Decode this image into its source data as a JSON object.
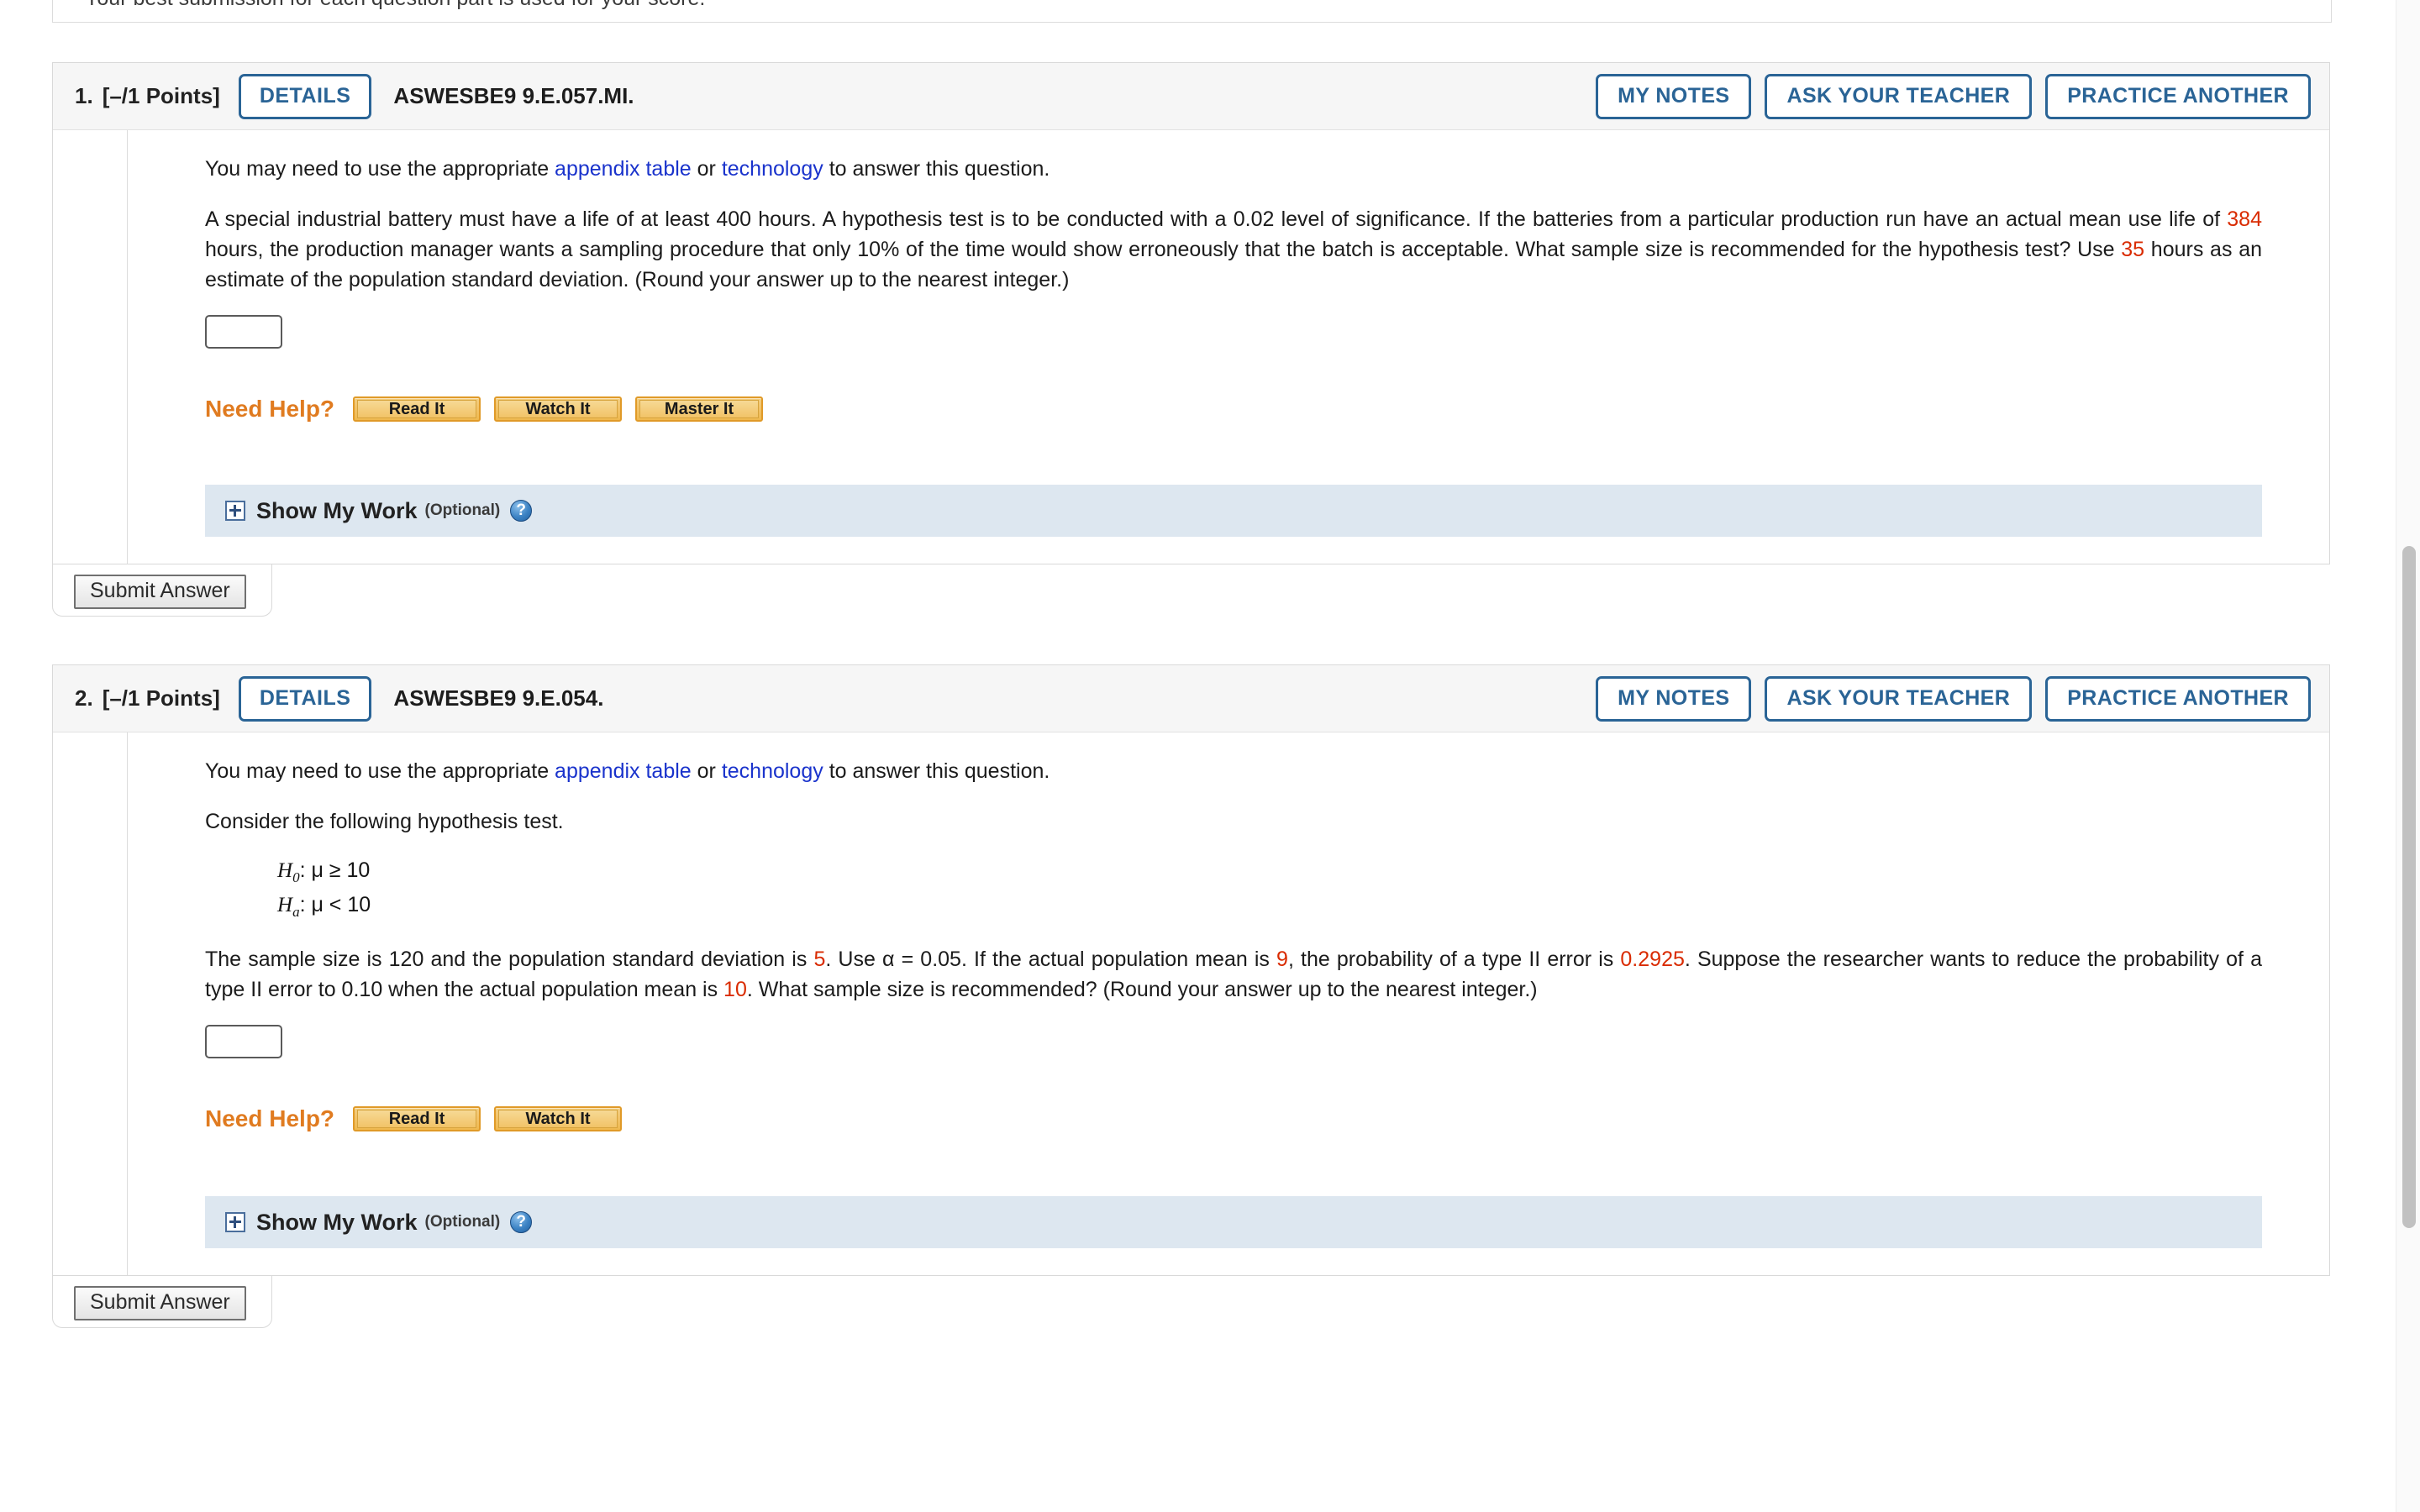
{
  "banner": {
    "text": "Your best submission for each question part is used for your score."
  },
  "intro_line": {
    "prefix": "You may need to use the appropriate ",
    "link1": "appendix table",
    "middle": " or ",
    "link2": "technology",
    "suffix": " to answer this question."
  },
  "help": {
    "label": "Need Help?",
    "read_it": "Read It",
    "watch_it": "Watch It",
    "master_it": "Master It"
  },
  "show_my_work": {
    "title": "Show My Work",
    "optional": "(Optional)",
    "help_icon": "?",
    "expand_icon": "+"
  },
  "submit": {
    "label": "Submit Answer"
  },
  "header_buttons": {
    "details": "DETAILS",
    "my_notes": "MY NOTES",
    "ask_your_teacher": "ASK YOUR TEACHER",
    "practice_another": "PRACTICE ANOTHER"
  },
  "questions": [
    {
      "number": "1.",
      "points": "[–/1 Points]",
      "code": "ASWESBE9 9.E.057.MI.",
      "body": {
        "seg1": "A special industrial battery must have a life of at least 400 hours. A hypothesis test is to be conducted with a 0.02 level of significance. If the batteries from a particular production run have an actual mean use life of ",
        "red1": "384",
        "seg2": " hours, the production manager wants a sampling procedure that only 10% of the time would show erroneously that the batch is acceptable. What sample size is recommended for the hypothesis test? Use ",
        "red2": "35",
        "seg3": " hours as an estimate of the population standard deviation. (Round your answer up to the nearest integer.)"
      },
      "answer_value": "",
      "help_buttons": [
        "Read It",
        "Watch It",
        "Master It"
      ]
    },
    {
      "number": "2.",
      "points": "[–/1 Points]",
      "code": "ASWESBE9 9.E.054.",
      "consider_line": "Consider the following hypothesis test.",
      "hypotheses": {
        "null_label": "H",
        "null_sub": "0",
        "null_rest": ": μ ≥ 10",
        "alt_label": "H",
        "alt_sub": "a",
        "alt_rest": ": μ < 10"
      },
      "body": {
        "seg1": "The sample size is 120 and the population standard deviation is ",
        "red1": "5",
        "seg2": ". Use α = 0.05. If the actual population mean is ",
        "red2": "9",
        "seg3": ", the probability of a type II error is ",
        "red3": "0.2925",
        "seg4": ". Suppose the researcher wants to reduce the probability of a type II error to 0.10 when the actual population mean is ",
        "red4": "10",
        "seg5": ". What sample size is recommended? (Round your answer up to the nearest integer.)"
      },
      "answer_value": "",
      "help_buttons": [
        "Read It",
        "Watch It"
      ]
    }
  ],
  "colors": {
    "accent_blue": "#2a6496",
    "link_blue": "#1a33cc",
    "red_value": "#d92b00",
    "orange": "#e07b20",
    "smw_bg": "#dde7f0"
  }
}
